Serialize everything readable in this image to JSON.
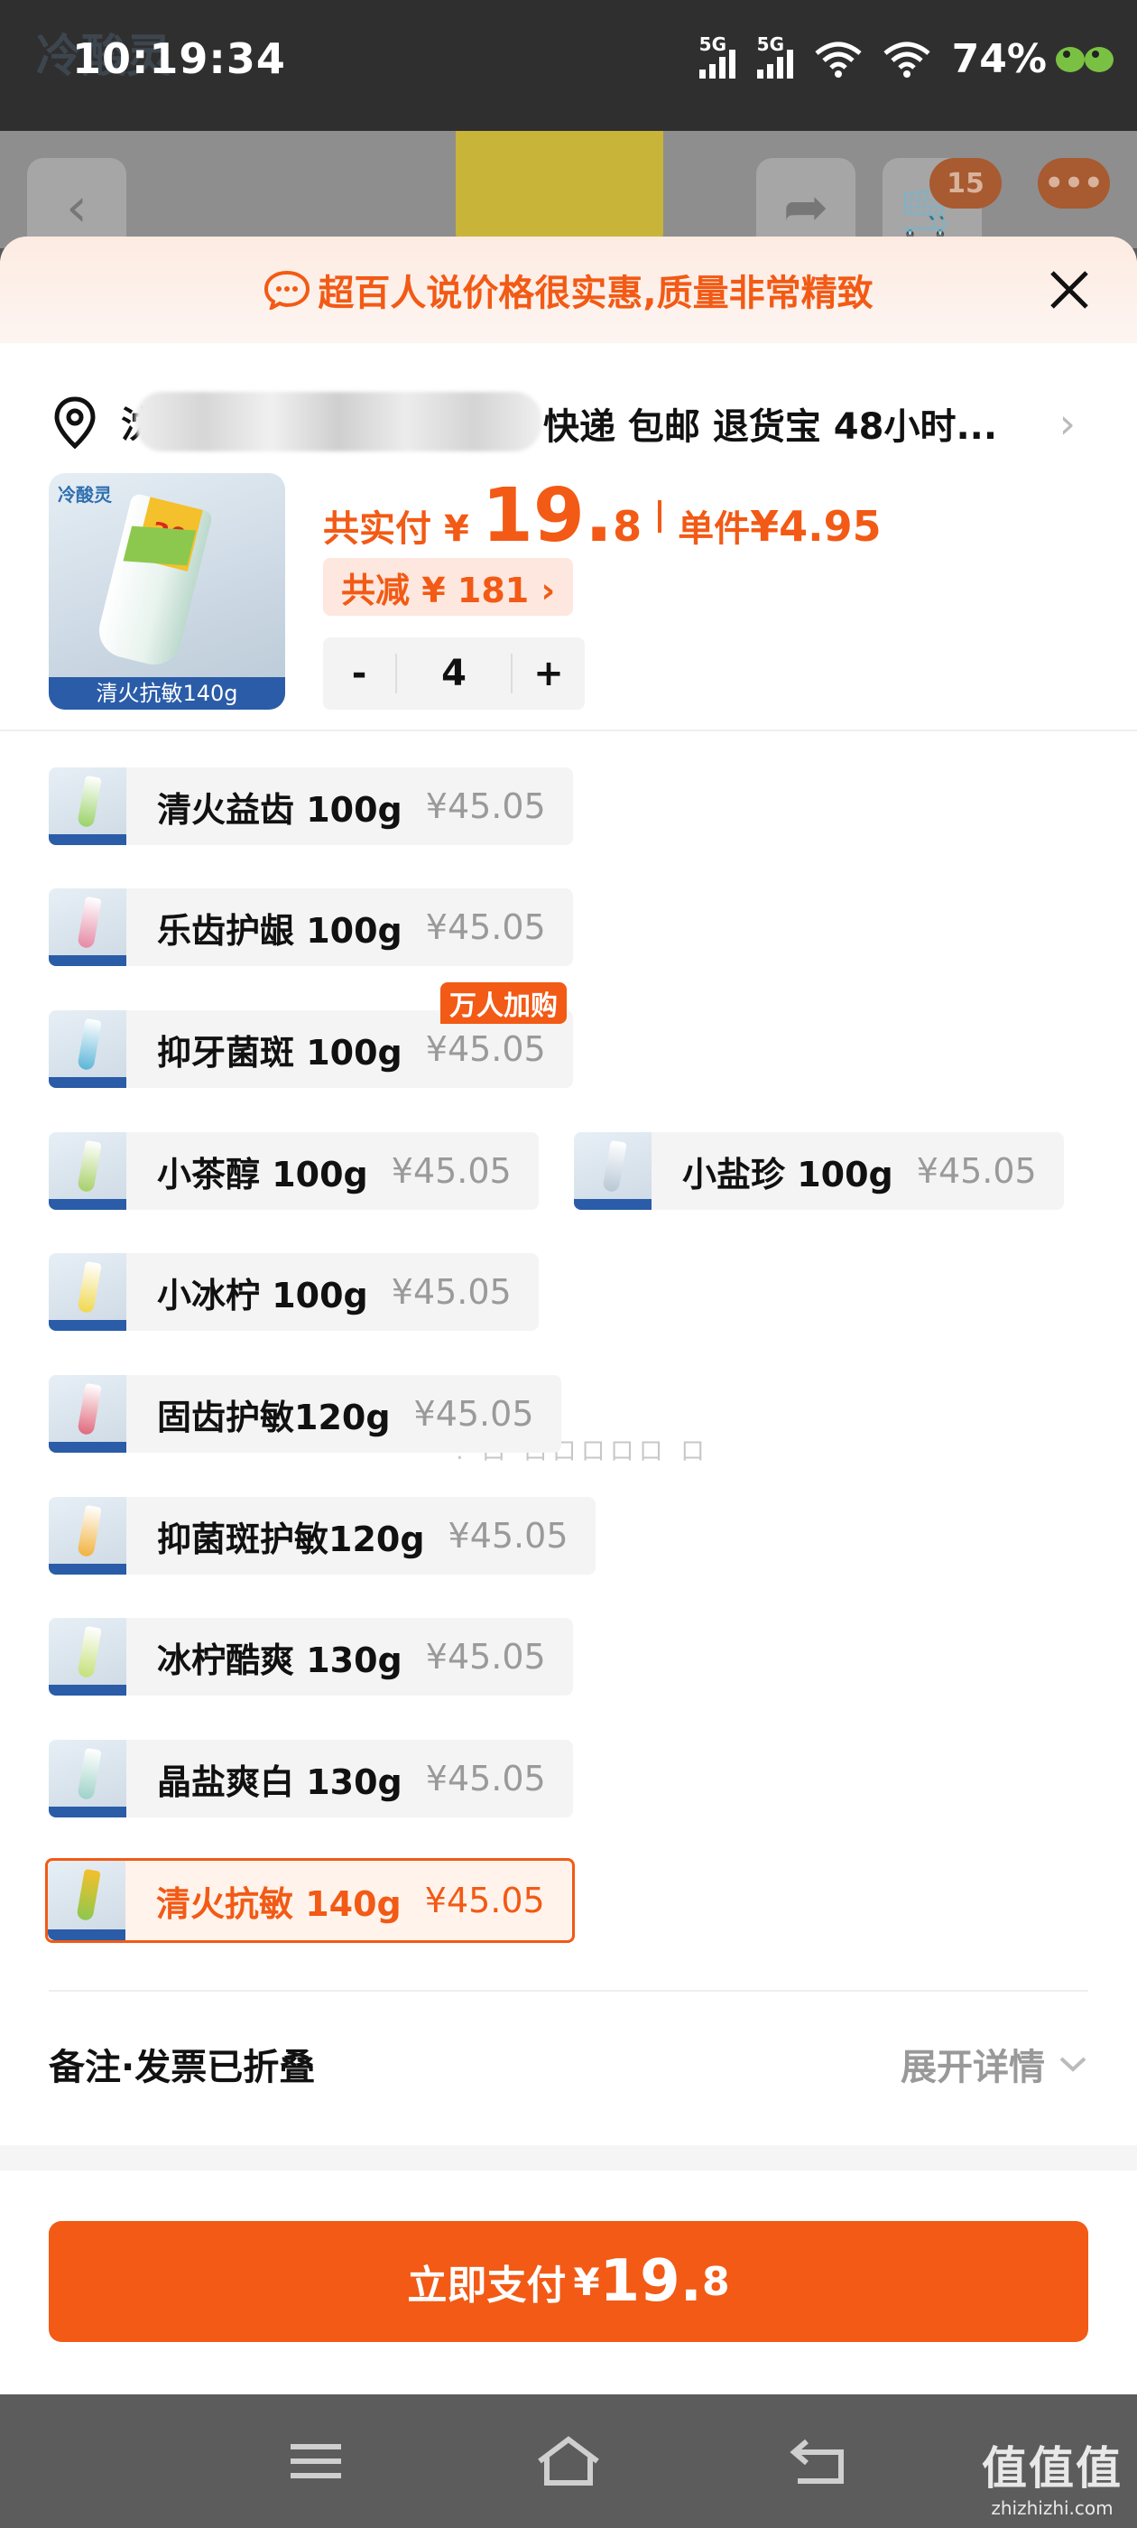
{
  "status_bar": {
    "time": "10:19:34",
    "ghost_logo": "冷酸灵",
    "net1": "5G",
    "net2": "5G",
    "battery": "74%"
  },
  "background_page": {
    "cart_count": "15",
    "more": "•••"
  },
  "banner": {
    "message": "超百人说价格很实惠,质量非常精致"
  },
  "address": {
    "visible_start": "沈",
    "shipping_info": "快递 包邮 退货宝 48小时..."
  },
  "product": {
    "brand": "冷酸灵",
    "tag": "30",
    "thumb_label": "清火抗敏140g",
    "total_label": "共实付",
    "currency": "¥",
    "total_int": "19.",
    "total_dec": "8",
    "unit_label": "单件",
    "unit_price": "¥4.95",
    "discount": "共减 ¥ 181 ›",
    "quantity": "4",
    "minus": "-",
    "plus": "+"
  },
  "hot_badge": "万人加购",
  "options": [
    {
      "name": "清火益齿 100g",
      "price": "¥45.05"
    },
    {
      "name": "乐齿护龈 100g",
      "price": "¥45.05"
    },
    {
      "name": "抑牙菌斑 100g",
      "price": "¥45.05"
    },
    {
      "name": "小茶醇 100g",
      "price": "¥45.05"
    },
    {
      "name": "小盐珍 100g",
      "price": "¥45.05"
    },
    {
      "name": "小冰柠 100g",
      "price": "¥45.05"
    },
    {
      "name": "固齿护敏120g",
      "price": "¥45.05"
    },
    {
      "name": "抑菌斑护敏120g",
      "price": "¥45.05"
    },
    {
      "name": "冰柠酷爽 130g",
      "price": "¥45.05"
    },
    {
      "name": "晶盐爽白 130g",
      "price": "¥45.05"
    },
    {
      "name": "清火抗敏 140g",
      "price": "¥45.05"
    }
  ],
  "garble_text": ": 口 口口口口口 口",
  "notes": {
    "label": "备注·发票已折叠",
    "expand": "展开详情"
  },
  "pay": {
    "label": "立即支付",
    "currency": "¥",
    "int": "19.",
    "dec": "8"
  },
  "watermark": {
    "big": "值值值",
    "small": "zhizhizhi.com"
  },
  "colors": {
    "accent": "#f25a15",
    "selected_bg": "#fff3ec"
  }
}
